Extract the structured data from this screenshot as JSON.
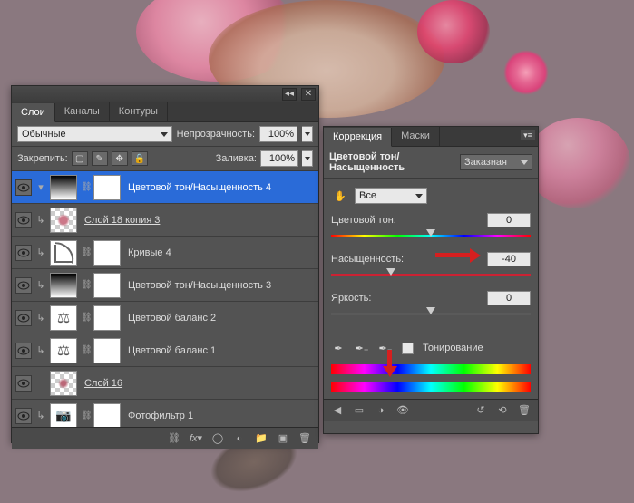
{
  "layers_panel": {
    "tabs": {
      "layers": "Слои",
      "channels": "Каналы",
      "paths": "Контуры"
    },
    "blend_mode": "Обычные",
    "opacity_label": "Непрозрачность:",
    "opacity_value": "100%",
    "lock_label": "Закрепить:",
    "fill_label": "Заливка:",
    "fill_value": "100%",
    "layers": [
      {
        "name": "Цветовой тон/Насыщенность 4"
      },
      {
        "name": "Слой 18 копия 3"
      },
      {
        "name": "Кривые 4"
      },
      {
        "name": "Цветовой тон/Насыщенность 3"
      },
      {
        "name": "Цветовой баланс 2"
      },
      {
        "name": "Цветовой баланс 1"
      },
      {
        "name": "Слой 16"
      },
      {
        "name": "Фотофильтр 1"
      }
    ]
  },
  "adj_panel": {
    "tabs": {
      "correction": "Коррекция",
      "masks": "Маски"
    },
    "title": "Цветовой тон/Насыщенность",
    "preset": "Заказная",
    "channel": "Все",
    "hue_label": "Цветовой тон:",
    "hue_value": "0",
    "sat_label": "Насыщенность:",
    "sat_value": "-40",
    "light_label": "Яркость:",
    "light_value": "0",
    "colorize_label": "Тонирование"
  }
}
